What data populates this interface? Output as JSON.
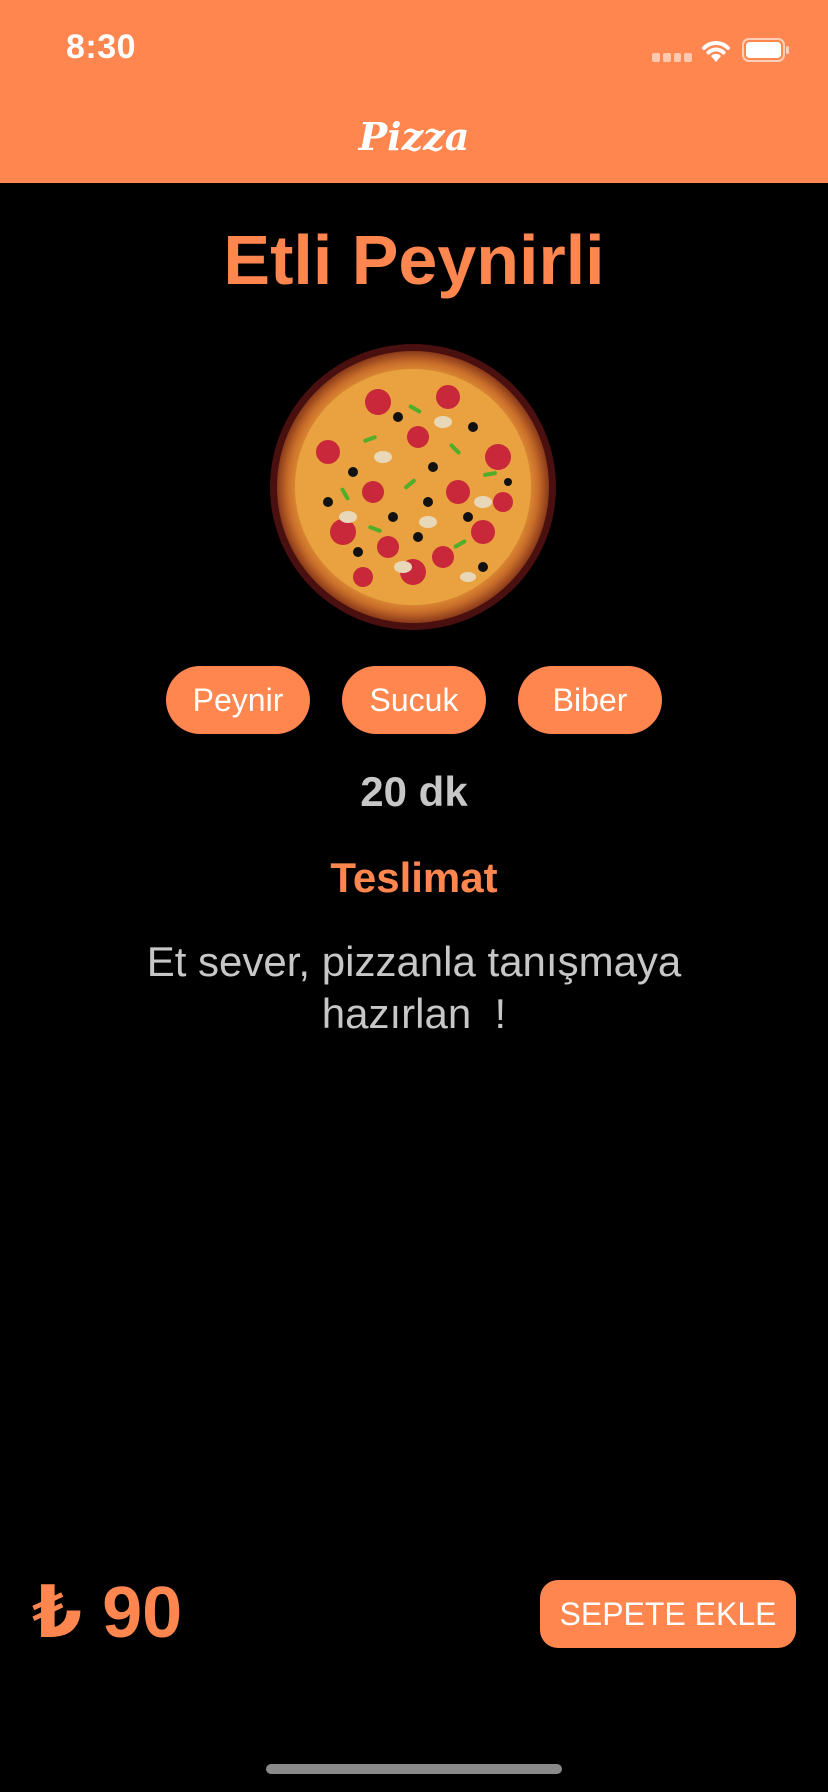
{
  "status_bar": {
    "time": "8:30"
  },
  "nav": {
    "title": "Pizza"
  },
  "product": {
    "name": "Etli Peynirli",
    "ingredients": [
      "Peynir",
      "Sucuk",
      "Biber"
    ],
    "delivery_time": "20 dk",
    "delivery_label": "Teslimat",
    "description": "Et sever, pizzanla tanışmaya\nhazırlan  !",
    "price": "₺ 90"
  },
  "actions": {
    "add_to_cart": "SEPETE EKLE"
  },
  "colors": {
    "accent": "#ff874f",
    "background": "#000000",
    "muted_text": "#c7c7c7"
  },
  "icons": {
    "signal": "cellular-signal-icon",
    "wifi": "wifi-icon",
    "battery": "battery-icon",
    "pizza": "pizza-image"
  }
}
